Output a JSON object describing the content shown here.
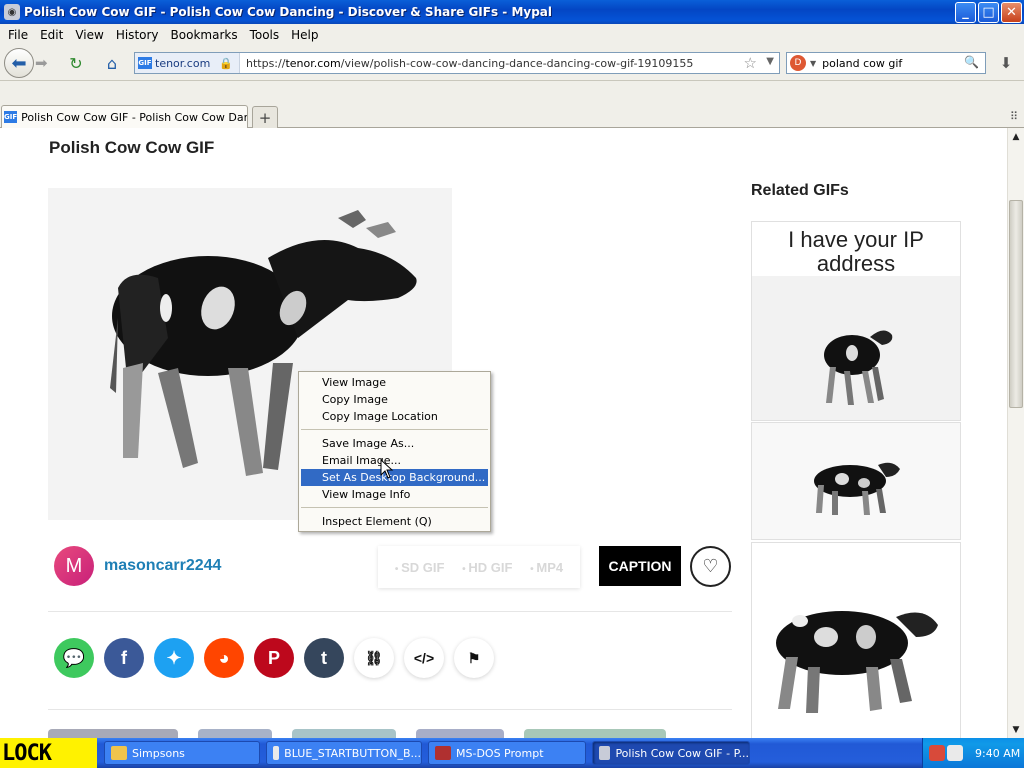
{
  "window": {
    "title": "Polish Cow Cow GIF - Polish Cow Cow Dancing - Discover & Share GIFs - Mypal",
    "buttons": {
      "minimize": "_",
      "maximize": "□",
      "close": "✕"
    }
  },
  "menu": {
    "items": [
      "File",
      "Edit",
      "View",
      "History",
      "Bookmarks",
      "Tools",
      "Help"
    ]
  },
  "nav": {
    "site_identity": "tenor.com",
    "site_favicon": "GIF",
    "url_prefix": "https://",
    "url_host": "tenor.com",
    "url_path": "/view/polish-cow-cow-dancing-dance-dancing-cow-gif-19109155",
    "search_query": "poland cow gif"
  },
  "tabs": {
    "items": [
      {
        "label": "Polish Cow Cow GIF - Polish Cow Cow Danci...",
        "favicon": "GIF"
      }
    ],
    "new_tab": "+"
  },
  "page": {
    "title": "Polish Cow Cow GIF",
    "related_title": "Related GIFs",
    "related_caption": "I have your IP address",
    "user": {
      "initial": "M",
      "name": "masoncarr2244"
    },
    "formats": [
      "SD GIF",
      "HD GIF",
      "MP4"
    ],
    "caption_button": "CAPTION",
    "share": [
      {
        "name": "message-icon",
        "glyph": "💬",
        "color": "#3ec95e"
      },
      {
        "name": "facebook-icon",
        "glyph": "f",
        "color": "#3b5998"
      },
      {
        "name": "twitter-icon",
        "glyph": "🐦",
        "color": "#1da1f2"
      },
      {
        "name": "reddit-icon",
        "glyph": "👽",
        "color": "#ff4500"
      },
      {
        "name": "pinterest-icon",
        "glyph": "P",
        "color": "#bd081c"
      },
      {
        "name": "tumblr-icon",
        "glyph": "t",
        "color": "#35465c"
      },
      {
        "name": "link-icon",
        "glyph": "🔗",
        "color": "#ffffff"
      },
      {
        "name": "embed-icon",
        "glyph": "</>",
        "color": "#ffffff"
      },
      {
        "name": "flag-icon",
        "glyph": "⚑",
        "color": "#ffffff"
      }
    ]
  },
  "context_menu": {
    "items": [
      "View Image",
      "Copy Image",
      "Copy Image Location",
      "Save Image As...",
      "Email Image...",
      "Set As Desktop Background...",
      "View Image Info",
      "Inspect Element (Q)"
    ],
    "highlighted": "Set As Desktop Background..."
  },
  "taskbar": {
    "start_label": "LOCK",
    "items": [
      "Simpsons",
      "BLUE_STARTBUTTON_B...",
      "MS-DOS Prompt",
      "Polish Cow Cow GIF - P..."
    ],
    "clock": "9:40 AM"
  },
  "colors": {
    "accent": "#316ac5",
    "username": "#1e7fb5",
    "titlebar": "#0553d6"
  }
}
